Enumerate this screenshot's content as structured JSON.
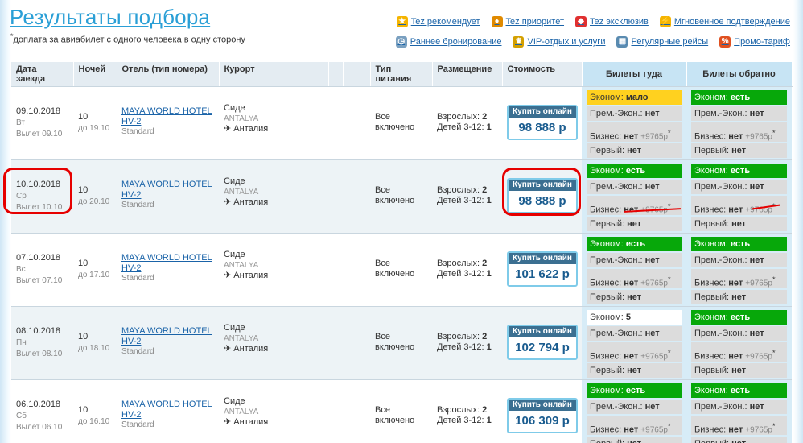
{
  "page": {
    "title": "Результаты подбора",
    "note_star": "*",
    "note": "доплата за авиабилет с одного человека в одну сторону"
  },
  "legend": [
    {
      "icon": "star-icon",
      "label": "Tez рекомендует",
      "color": "#f5b400"
    },
    {
      "icon": "medal-icon",
      "label": "Tez приоритет",
      "color": "#e08a00"
    },
    {
      "icon": "only-icon",
      "label": "Tez эксклюзив",
      "color": "#e03030"
    },
    {
      "icon": "lightning-icon",
      "label": "Мгновенное подтверждение",
      "color": "#f5b400"
    },
    {
      "icon": "search-clock-icon",
      "label": "Раннее бронирование",
      "color": "#7aa0c0"
    },
    {
      "icon": "vip-icon",
      "label": "VIP-отдых и услуги",
      "color": "#d4a000"
    },
    {
      "icon": "calendar-icon",
      "label": "Регулярные рейсы",
      "color": "#5a8bb0"
    },
    {
      "icon": "percent-icon",
      "label": "Промо-тариф",
      "color": "#e05020"
    }
  ],
  "columns": {
    "date": "Дата заезда",
    "nights": "Ночей",
    "hotel": "Отель (тип номера)",
    "resort": "Курорт",
    "food": "Тип питания",
    "placement": "Размещение",
    "price": "Стоимость",
    "tickets_to": "Билеты туда",
    "tickets_back": "Билеты обратно"
  },
  "labels": {
    "buy": "Купить онлайн",
    "adults": "Взрослых:",
    "children": "Детей 3-12:",
    "flight_prefix": "Вылет",
    "arrow": "✈"
  },
  "rows": [
    {
      "date": "09.10.2018",
      "weekday": "Вт",
      "flight": "Вылет 09.10",
      "nights": "10",
      "until": "до 19.10",
      "hotel": "MAYA WORLD HOTEL HV-2",
      "room": "Standard",
      "resort": "Сиде",
      "region": "ANTALYA",
      "country": "Анталия",
      "food": "Все включено",
      "adults": "2",
      "children": "1",
      "price": "98 888 р",
      "to": [
        {
          "label": "Эконом:",
          "value": "мало",
          "style": "yellow"
        },
        {
          "label": "Прем.-Экон.:",
          "value": "нет",
          "style": "grey"
        },
        {
          "label": "Бизнес:",
          "value": "нет",
          "extra": "+9765р",
          "style": "grey"
        },
        {
          "label": "Первый:",
          "value": "нет",
          "style": "grey"
        }
      ],
      "back": [
        {
          "label": "Эконом:",
          "value": "есть",
          "style": "green"
        },
        {
          "label": "Прем.-Экон.:",
          "value": "нет",
          "style": "grey"
        },
        {
          "label": "Бизнес:",
          "value": "нет",
          "extra": "+9765р",
          "style": "grey"
        },
        {
          "label": "Первый:",
          "value": "нет",
          "style": "grey"
        }
      ]
    },
    {
      "date": "10.10.2018",
      "weekday": "Ср",
      "flight": "Вылет 10.10",
      "nights": "10",
      "until": "до 20.10",
      "hotel": "MAYA WORLD HOTEL HV-2",
      "room": "Standard",
      "resort": "Сиде",
      "region": "ANTALYA",
      "country": "Анталия",
      "food": "Все включено",
      "adults": "2",
      "children": "1",
      "price": "98 888 р",
      "to": [
        {
          "label": "Эконом:",
          "value": "есть",
          "style": "green"
        },
        {
          "label": "Прем.-Экон.:",
          "value": "нет",
          "style": "grey"
        },
        {
          "label": "Бизнес:",
          "value": "нет",
          "extra": "+9765р",
          "style": "grey"
        },
        {
          "label": "Первый:",
          "value": "нет",
          "style": "grey"
        }
      ],
      "back": [
        {
          "label": "Эконом:",
          "value": "есть",
          "style": "green"
        },
        {
          "label": "Прем.-Экон.:",
          "value": "нет",
          "style": "grey"
        },
        {
          "label": "Бизнес:",
          "value": "нет",
          "extra": "+9765р",
          "style": "grey"
        },
        {
          "label": "Первый:",
          "value": "нет",
          "style": "grey"
        }
      ]
    },
    {
      "date": "07.10.2018",
      "weekday": "Вс",
      "flight": "Вылет 07.10",
      "nights": "10",
      "until": "до 17.10",
      "hotel": "MAYA WORLD HOTEL HV-2",
      "room": "Standard",
      "resort": "Сиде",
      "region": "ANTALYA",
      "country": "Анталия",
      "food": "Все включено",
      "adults": "2",
      "children": "1",
      "price": "101 622 р",
      "to": [
        {
          "label": "Эконом:",
          "value": "есть",
          "style": "green"
        },
        {
          "label": "Прем.-Экон.:",
          "value": "нет",
          "style": "grey"
        },
        {
          "label": "Бизнес:",
          "value": "нет",
          "extra": "+9765р",
          "style": "grey"
        },
        {
          "label": "Первый:",
          "value": "нет",
          "style": "grey"
        }
      ],
      "back": [
        {
          "label": "Эконом:",
          "value": "есть",
          "style": "green"
        },
        {
          "label": "Прем.-Экон.:",
          "value": "нет",
          "style": "grey"
        },
        {
          "label": "Бизнес:",
          "value": "нет",
          "extra": "+9765р",
          "style": "grey"
        },
        {
          "label": "Первый:",
          "value": "нет",
          "style": "grey"
        }
      ]
    },
    {
      "date": "08.10.2018",
      "weekday": "Пн",
      "flight": "Вылет 08.10",
      "nights": "10",
      "until": "до 18.10",
      "hotel": "MAYA WORLD HOTEL HV-2",
      "room": "Standard",
      "resort": "Сиде",
      "region": "ANTALYA",
      "country": "Анталия",
      "food": "Все включено",
      "adults": "2",
      "children": "1",
      "price": "102 794 р",
      "to": [
        {
          "label": "Эконом:",
          "value": "5",
          "style": "white"
        },
        {
          "label": "Прем.-Экон.:",
          "value": "нет",
          "style": "grey"
        },
        {
          "label": "Бизнес:",
          "value": "нет",
          "extra": "+9765р",
          "style": "grey"
        },
        {
          "label": "Первый:",
          "value": "нет",
          "style": "grey"
        }
      ],
      "back": [
        {
          "label": "Эконом:",
          "value": "есть",
          "style": "green"
        },
        {
          "label": "Прем.-Экон.:",
          "value": "нет",
          "style": "grey"
        },
        {
          "label": "Бизнес:",
          "value": "нет",
          "extra": "+9765р",
          "style": "grey"
        },
        {
          "label": "Первый:",
          "value": "нет",
          "style": "grey"
        }
      ]
    },
    {
      "date": "06.10.2018",
      "weekday": "Сб",
      "flight": "Вылет 06.10",
      "nights": "10",
      "until": "до 16.10",
      "hotel": "MAYA WORLD HOTEL HV-2",
      "room": "Standard",
      "resort": "Сиде",
      "region": "ANTALYA",
      "country": "Анталия",
      "food": "Все включено",
      "adults": "2",
      "children": "1",
      "price": "106 309 р",
      "to": [
        {
          "label": "Эконом:",
          "value": "есть",
          "style": "green"
        },
        {
          "label": "Прем.-Экон.:",
          "value": "нет",
          "style": "grey"
        },
        {
          "label": "Бизнес:",
          "value": "нет",
          "extra": "+9765р",
          "style": "grey"
        },
        {
          "label": "Первый:",
          "value": "нет",
          "style": "grey"
        }
      ],
      "back": [
        {
          "label": "Эконом:",
          "value": "есть",
          "style": "green"
        },
        {
          "label": "Прем.-Экон.:",
          "value": "нет",
          "style": "grey"
        },
        {
          "label": "Бизнес:",
          "value": "нет",
          "extra": "+9765р",
          "style": "grey"
        },
        {
          "label": "Первый:",
          "value": "нет",
          "style": "grey"
        }
      ]
    }
  ]
}
